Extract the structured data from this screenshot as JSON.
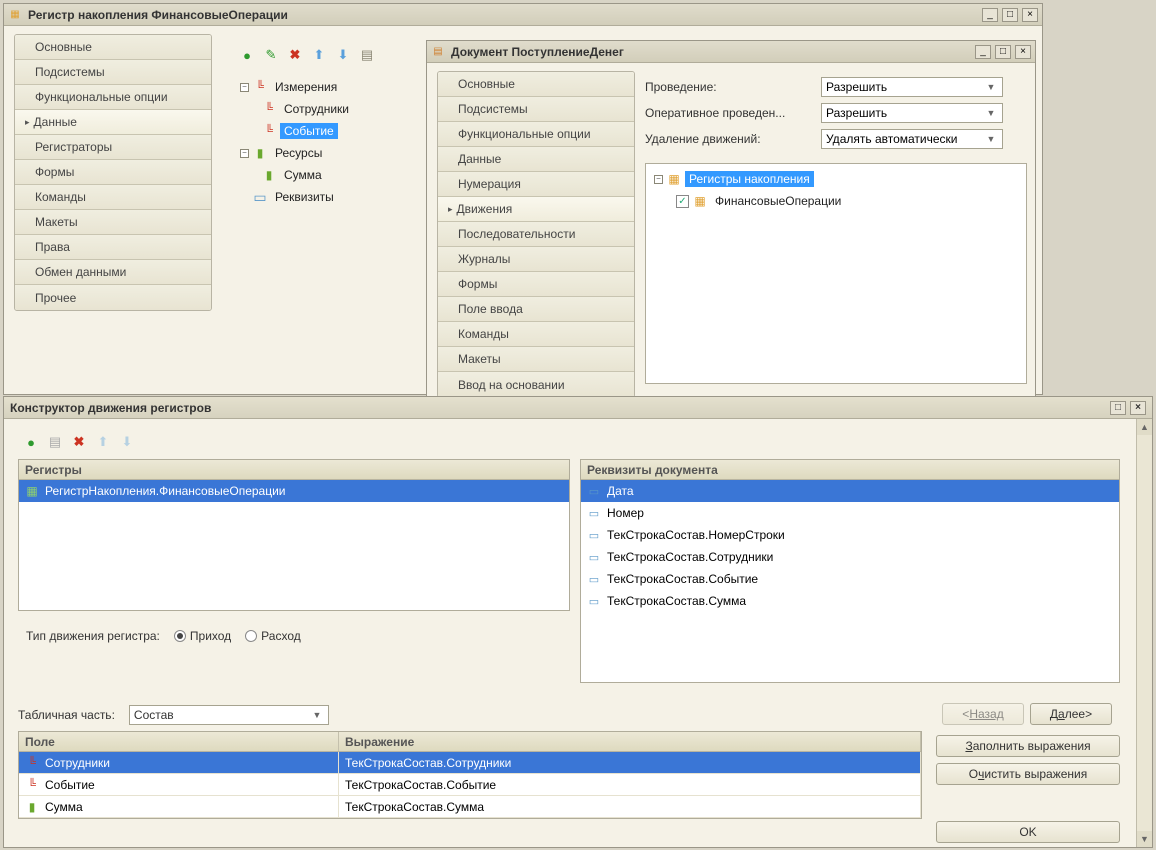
{
  "win1": {
    "title": "Регистр накопления ФинансовыеОперации",
    "nav": [
      "Основные",
      "Подсистемы",
      "Функциональные опции",
      "Данные",
      "Регистраторы",
      "Формы",
      "Команды",
      "Макеты",
      "Права",
      "Обмен данными",
      "Прочее"
    ],
    "nav_active_index": 3,
    "tree": {
      "dimensions": {
        "label": "Измерения",
        "items": [
          "Сотрудники",
          "Событие"
        ],
        "selected_index": 1
      },
      "resources": {
        "label": "Ресурсы",
        "items": [
          "Сумма"
        ]
      },
      "attributes": {
        "label": "Реквизиты"
      }
    }
  },
  "win2": {
    "title": "Документ ПоступлениеДенег",
    "nav": [
      "Основные",
      "Подсистемы",
      "Функциональные опции",
      "Данные",
      "Нумерация",
      "Движения",
      "Последовательности",
      "Журналы",
      "Формы",
      "Поле ввода",
      "Команды",
      "Макеты",
      "Ввод на основании"
    ],
    "nav_active_index": 5,
    "props": {
      "p1_label": "Проведение:",
      "p1_value": "Разрешить",
      "p2_label": "Оперативное проведен...",
      "p2_value": "Разрешить",
      "p3_label": "Удаление движений:",
      "p3_value": "Удалять автоматически"
    },
    "regtree": {
      "group": "Регистры накопления",
      "item": "ФинансовыеОперации",
      "checked": true
    }
  },
  "win3": {
    "title": "Конструктор движения регистров",
    "registers_header": "Регистры",
    "registers_item": "РегистрНакопления.ФинансовыеОперации",
    "doc_attrs_header": "Реквизиты документа",
    "doc_attrs": [
      "Дата",
      "Номер",
      "ТекСтрокаСостав.НомерСтроки",
      "ТекСтрокаСостав.Сотрудники",
      "ТекСтрокаСостав.Событие",
      "ТекСтрокаСостав.Сумма"
    ],
    "doc_attrs_selected_index": 0,
    "movement_type_label": "Тип движения регистра:",
    "radio_income": "Приход",
    "radio_expense": "Расход",
    "tab_part_label": "Табличная часть:",
    "tab_part_value": "Состав",
    "btn_back": "Назад",
    "btn_next": "Далее>",
    "btn_fill": "аполнить выражения",
    "btn_fill_u": "З",
    "btn_clear_pre": "О",
    "btn_clear": "истить выражения",
    "btn_clear_u": "ч",
    "btn_ok": "OK",
    "table": {
      "col_field": "Поле",
      "col_expr": "Выражение",
      "rows": [
        {
          "field": "Сотрудники",
          "expr": "ТекСтрокаСостав.Сотрудники",
          "icon": "axis",
          "sel": true
        },
        {
          "field": "Событие",
          "expr": "ТекСтрокаСостав.Событие",
          "icon": "axis"
        },
        {
          "field": "Сумма",
          "expr": "ТекСтрокаСостав.Сумма",
          "icon": "res"
        }
      ]
    }
  }
}
